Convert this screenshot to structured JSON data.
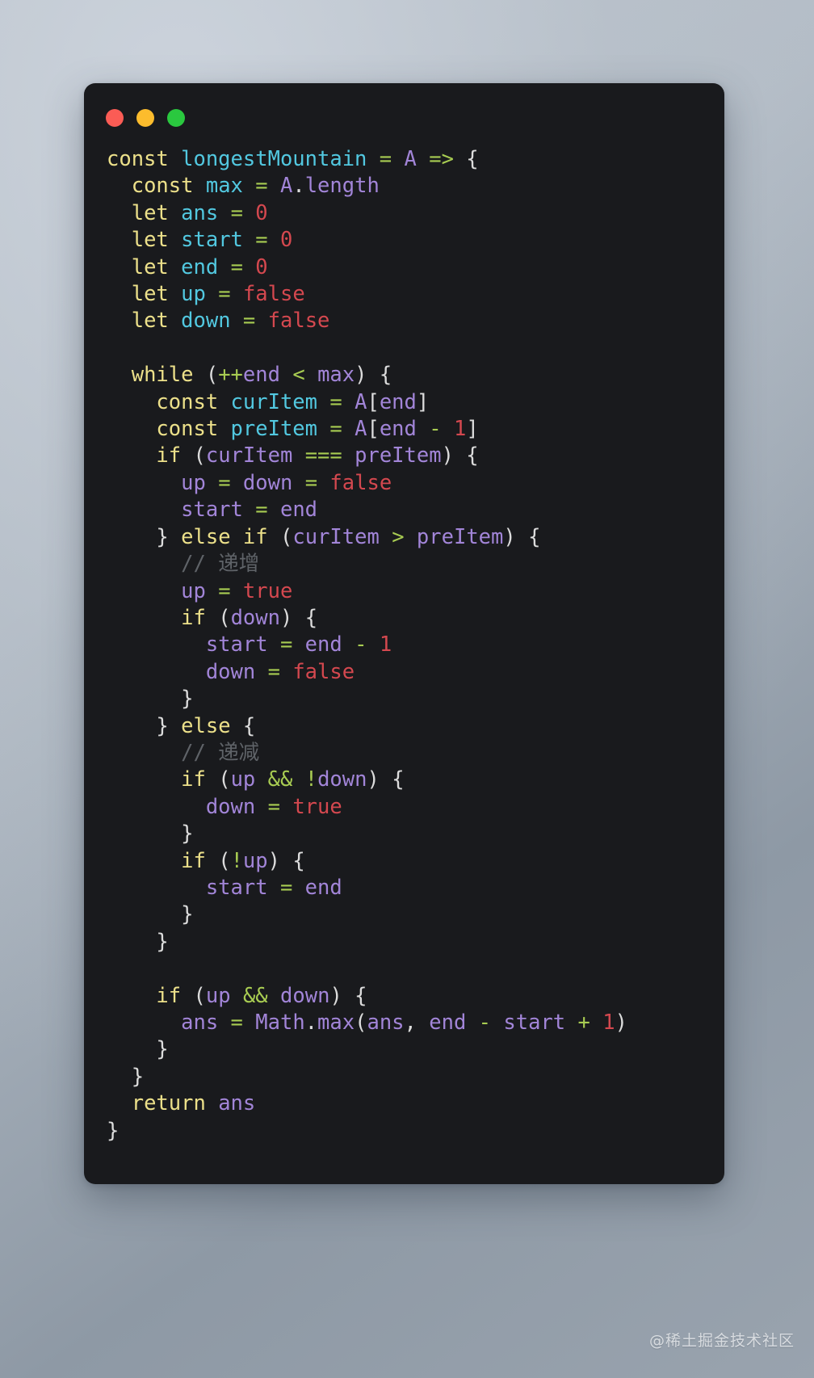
{
  "window": {
    "traffic_lights": [
      {
        "name": "close-button",
        "label": "close",
        "color": "#fb5c55"
      },
      {
        "name": "minimize-button",
        "label": "minimize",
        "color": "#fcbc2d"
      },
      {
        "name": "maximize-button",
        "label": "maximize",
        "color": "#2ac83f"
      }
    ]
  },
  "code": {
    "language": "javascript",
    "function_name": "longestMountain",
    "text": "const longestMountain = A => {\n  const max = A.length\n  let ans = 0\n  let start = 0\n  let end = 0\n  let up = false\n  let down = false\n\n  while (++end < max) {\n    const curItem = A[end]\n    const preItem = A[end - 1]\n    if (curItem === preItem) {\n      up = down = false\n      start = end\n    } else if (curItem > preItem) {\n      // 递增\n      up = true\n      if (down) {\n        start = end - 1\n        down = false\n      }\n    } else {\n      // 递减\n      if (up && !down) {\n        down = true\n      }\n      if (!up) {\n        start = end\n      }\n    }\n\n    if (up && down) {\n      ans = Math.max(ans, end - start + 1)\n    }\n  }\n  return ans\n}",
    "comments": [
      "// 递增",
      "// 递减"
    ],
    "lines": [
      "const longestMountain = A => {",
      "  const max = A.length",
      "  let ans = 0",
      "  let start = 0",
      "  let end = 0",
      "  let up = false",
      "  let down = false",
      "",
      "  while (++end < max) {",
      "    const curItem = A[end]",
      "    const preItem = A[end - 1]",
      "    if (curItem === preItem) {",
      "      up = down = false",
      "      start = end",
      "    } else if (curItem > preItem) {",
      "      // 递增",
      "      up = true",
      "      if (down) {",
      "        start = end - 1",
      "        down = false",
      "      }",
      "    } else {",
      "      // 递减",
      "      if (up && !down) {",
      "        down = true",
      "      }",
      "      if (!up) {",
      "        start = end",
      "      }",
      "    }",
      "",
      "    if (up && down) {",
      "      ans = Math.max(ans, end - start + 1)",
      "    }",
      "  }",
      "  return ans",
      "}"
    ]
  },
  "watermark": {
    "text": "@稀土掘金技术社区"
  },
  "colors": {
    "background_top": "#bcc4cd",
    "background_bottom": "#99a3ae",
    "panel": "#191a1d",
    "keyword": "#ece08a",
    "declaration": "#52c8e0",
    "operator": "#a8cc52",
    "number": "#d4484f",
    "boolean": "#d4484f",
    "identifier": "#a285d8",
    "punctuation": "#dcdcdc",
    "comment": "#5f6368"
  }
}
